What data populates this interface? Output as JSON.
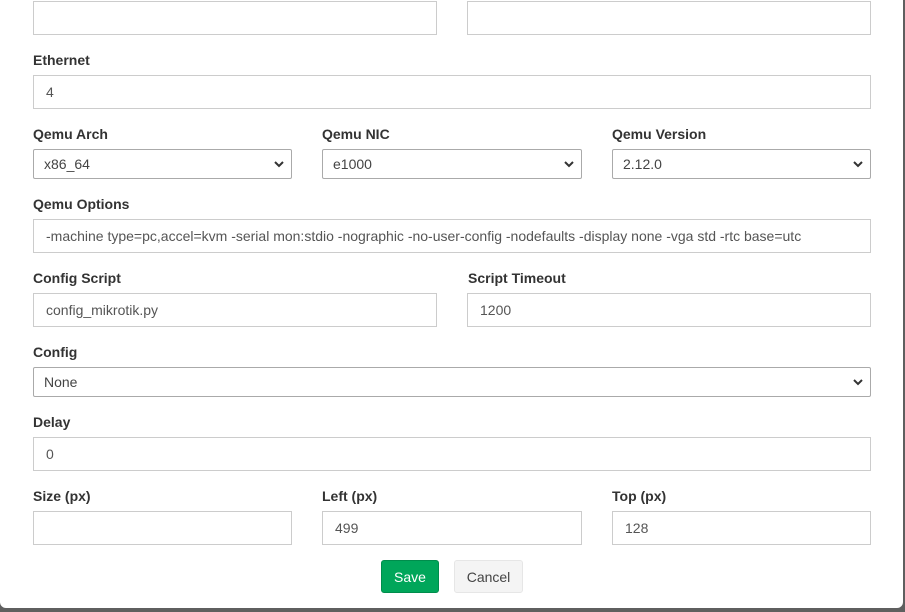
{
  "form": {
    "top_left_value": "",
    "top_right_value": "",
    "ethernet": {
      "label": "Ethernet",
      "value": "4"
    },
    "qemu_arch": {
      "label": "Qemu Arch",
      "selected": "x86_64"
    },
    "qemu_nic": {
      "label": "Qemu NIC",
      "selected": "e1000"
    },
    "qemu_version": {
      "label": "Qemu Version",
      "selected": "2.12.0"
    },
    "qemu_options": {
      "label": "Qemu Options",
      "value": "-machine type=pc,accel=kvm -serial mon:stdio -nographic -no-user-config -nodefaults -display none -vga std -rtc base=utc"
    },
    "config_script": {
      "label": "Config Script",
      "value": "config_mikrotik.py"
    },
    "script_timeout": {
      "label": "Script Timeout",
      "value": "1200"
    },
    "config": {
      "label": "Config",
      "selected": "None"
    },
    "delay": {
      "label": "Delay",
      "value": "0"
    },
    "size": {
      "label": "Size (px)",
      "value": ""
    },
    "left": {
      "label": "Left (px)",
      "value": "499"
    },
    "top": {
      "label": "Top (px)",
      "value": "128"
    }
  },
  "buttons": {
    "save": "Save",
    "cancel": "Cancel"
  },
  "colors": {
    "save": "#00a65a",
    "cancel": "#f4f4f4",
    "backdrop": "#5f5f5f"
  },
  "icons": {
    "select_arrow": "chevron-down-icon"
  }
}
